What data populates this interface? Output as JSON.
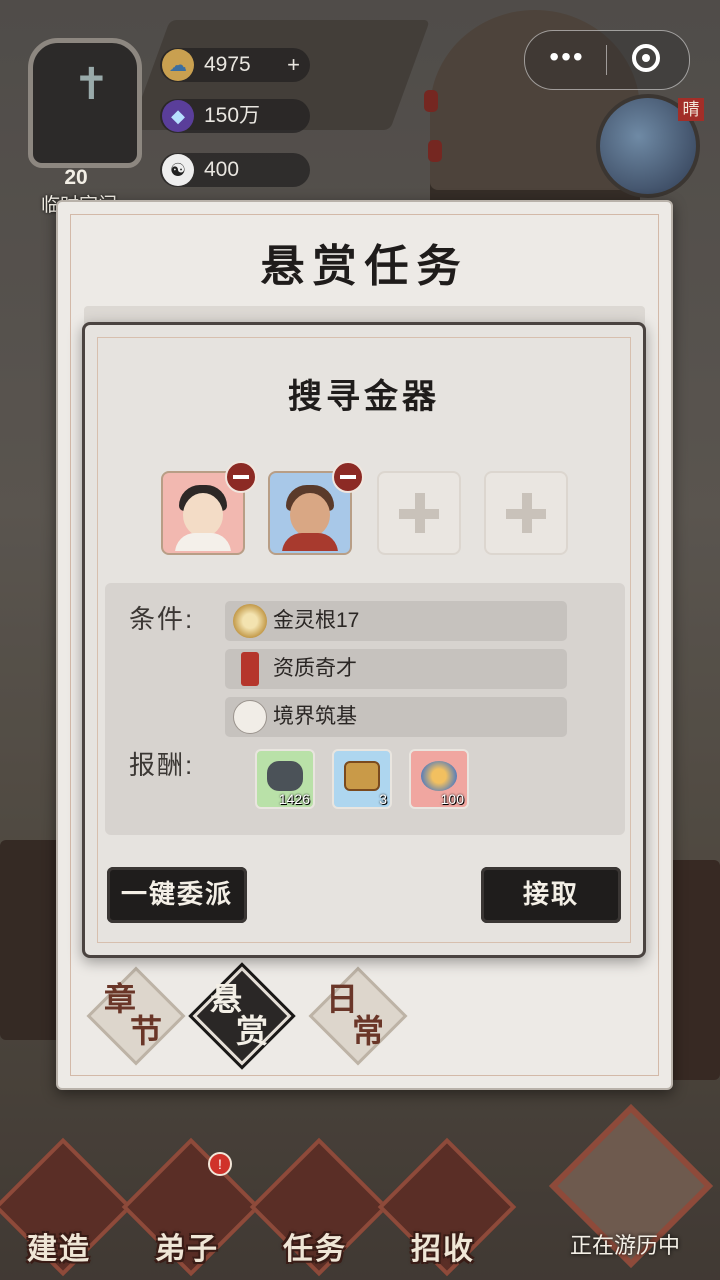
{
  "hud": {
    "sect_level": "20",
    "sect_name": "临时宗门",
    "resources": [
      {
        "icon": "spirit-cloud-icon",
        "value": "4975",
        "has_plus": true,
        "plus": "+"
      },
      {
        "icon": "purple-crystal-icon",
        "value": "150万"
      },
      {
        "icon": "yin-yang-icon",
        "value": "400"
      }
    ],
    "clock_tag": "晴"
  },
  "panel": {
    "title": "悬赏任务",
    "tabs": [
      {
        "t1": "章",
        "t2": "节",
        "active": false
      },
      {
        "t1": "悬",
        "t2": "赏",
        "active": true
      },
      {
        "t1": "日",
        "t2": "常",
        "active": false
      }
    ]
  },
  "dialog": {
    "title": "搜寻金器",
    "slots": [
      {
        "state": "filled",
        "character": "female-disciple"
      },
      {
        "state": "filled",
        "character": "bearded-warrior"
      },
      {
        "state": "empty"
      },
      {
        "state": "empty"
      }
    ],
    "conditions_label": "条件:",
    "conditions": [
      {
        "icon": "gold-spirit-root-icon",
        "text": "金灵根17"
      },
      {
        "icon": "talent-seal-icon",
        "text": "资质奇才"
      },
      {
        "icon": "meditation-icon",
        "text": "境界筑基"
      }
    ],
    "rewards_label": "报酬:",
    "rewards": [
      {
        "icon": "ore-icon",
        "count": "1426"
      },
      {
        "icon": "treasure-chest-icon",
        "count": "3"
      },
      {
        "icon": "spirit-cloud-icon",
        "count": "100"
      }
    ],
    "buttons": {
      "auto_assign": "一键委派",
      "accept": "接取"
    }
  },
  "bottom_nav": {
    "items": [
      {
        "label": "建造",
        "badge": false
      },
      {
        "label": "弟子",
        "badge": true
      },
      {
        "label": "任务",
        "badge": false
      },
      {
        "label": "招收",
        "badge": false
      }
    ],
    "travel_label": "正在游历中"
  },
  "colors": {
    "panel_bg": "#edeae6",
    "button_bg": "#1f1d1c",
    "accent_red": "#a22e28",
    "tab_text": "#6a3628"
  }
}
